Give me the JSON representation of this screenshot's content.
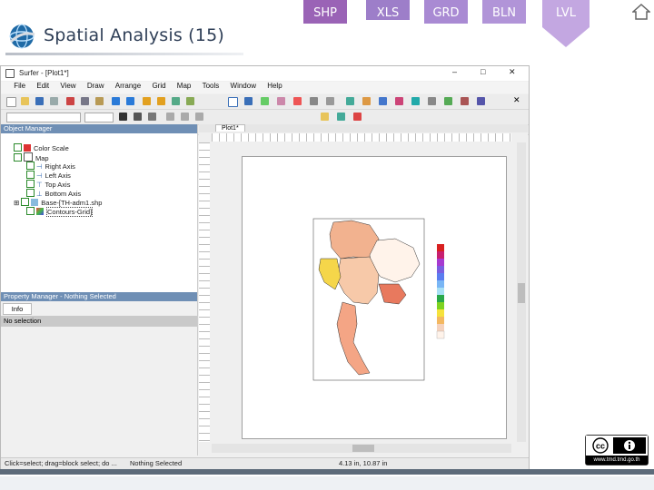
{
  "slide": {
    "title": "Spatial Analysis (15)",
    "tabs": [
      "SHP",
      "XLS",
      "GRD",
      "BLN",
      "LVL"
    ],
    "license_url": "www.tmd.tmd.go.th"
  },
  "app": {
    "window_title": "Surfer - [Plot1*]",
    "menus": [
      "File",
      "Edit",
      "View",
      "Draw",
      "Arrange",
      "Grid",
      "Map",
      "Tools",
      "Window",
      "Help"
    ],
    "doc_tab": "Plot1*"
  },
  "object_manager": {
    "header": "Object Manager",
    "items": [
      "Color Scale",
      "Map",
      "Right Axis",
      "Left Axis",
      "Top Axis",
      "Bottom Axis",
      "Base-[TH-adm1.shp",
      "Contours-Grid]"
    ]
  },
  "property_manager": {
    "header": "Property Manager - Nothing Selected",
    "tab": "Info",
    "message": "No selection"
  },
  "statusbar": {
    "hint": "Click=select; drag=block select; do ...",
    "selection": "Nothing Selected",
    "coords": "4.13 in, 10.87 in"
  },
  "colors": {
    "tab_purple": "#9a63b6",
    "panel_blue": "#6f8fb5"
  }
}
